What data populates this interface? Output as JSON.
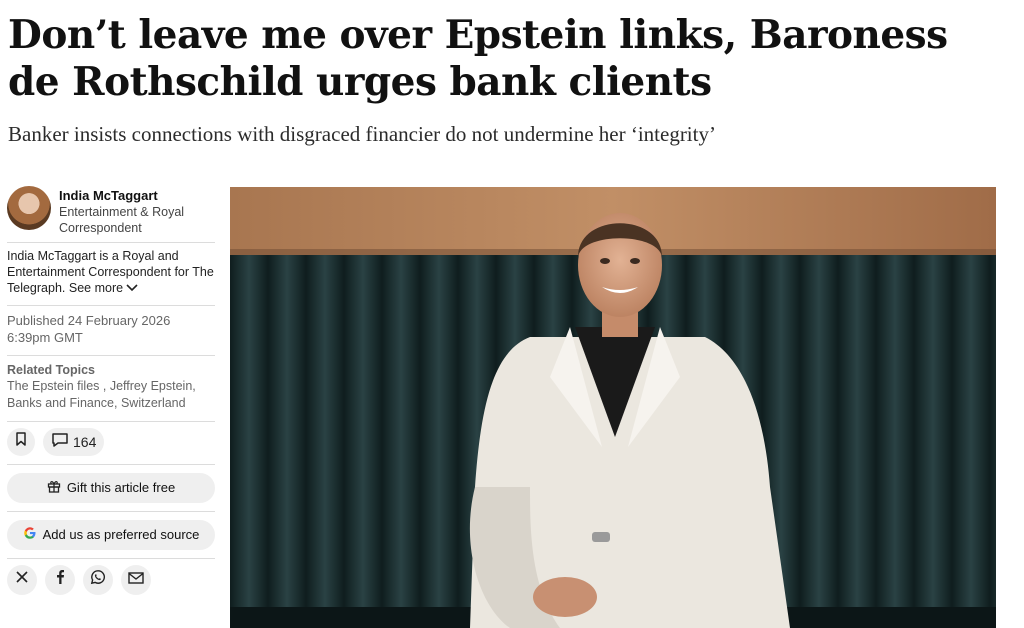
{
  "article": {
    "headline": "Don’t leave me over Epstein links, Baroness de Rothschild urges bank clients",
    "standfirst": "Banker insists connections with disgraced financier do not undermine her ‘integrity’"
  },
  "author": {
    "name": "India McTaggart",
    "role": "Entertainment & Royal Correspondent",
    "bio": "India McTaggart is a Royal and Entertainment Correspondent for The Telegraph.",
    "see_more": "See more"
  },
  "published": {
    "date": "Published 24 February 2026",
    "time": "6:39pm GMT"
  },
  "related": {
    "title": "Related Topics",
    "topics_text": "The Epstein files , Jeffrey Epstein, Banks and Finance, Switzerland"
  },
  "actions": {
    "comment_count": "164",
    "gift_label": "Gift this article free",
    "source_label": "Add us as preferred source"
  },
  "share": {
    "icons": [
      "x-icon",
      "facebook-icon",
      "whatsapp-icon",
      "email-icon"
    ]
  },
  "colors": {
    "chip_bg": "#efefef",
    "wood": "#b9865b",
    "banquette": "#1e3233",
    "suit": "#ece8e1"
  }
}
